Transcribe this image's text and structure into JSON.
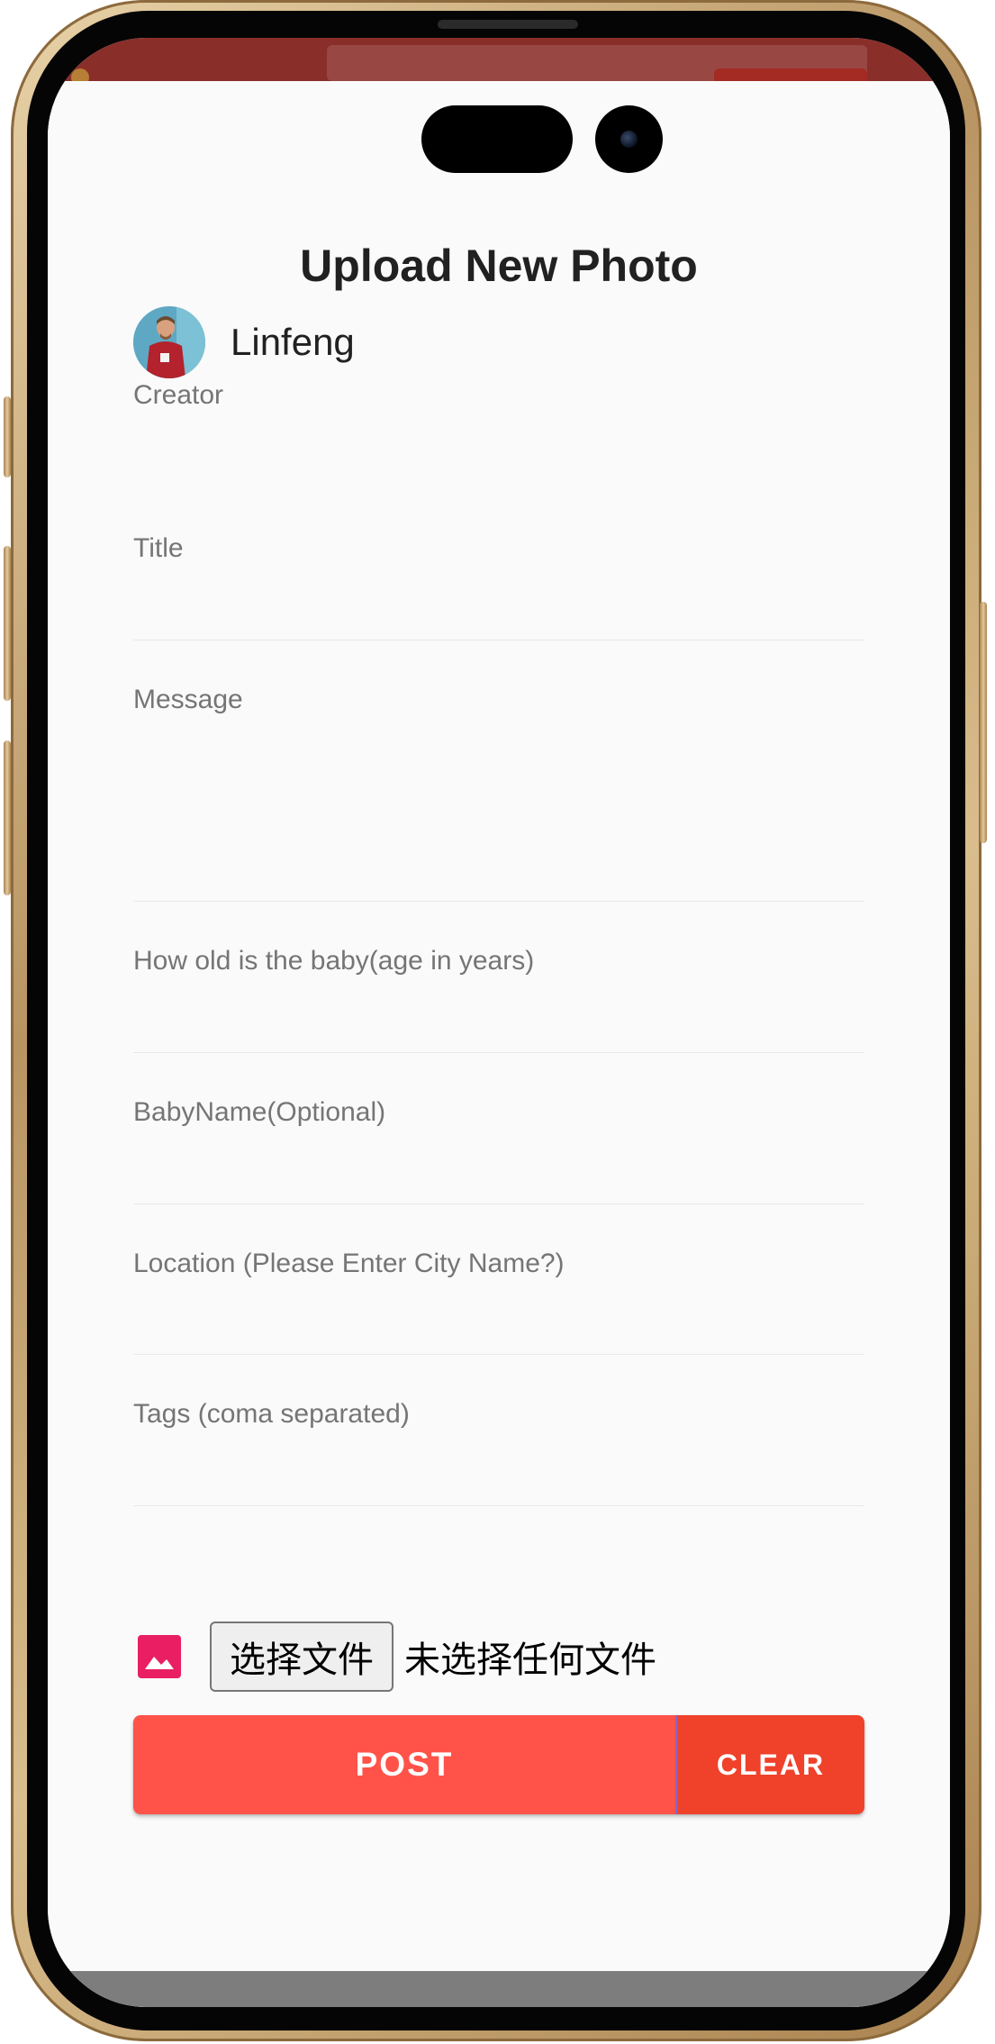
{
  "form": {
    "title": "Upload New Photo",
    "creator_name": "Linfeng",
    "creator_label": "Creator",
    "fields": {
      "title": "Title",
      "message": "Message",
      "age": "How old is the baby(age in years)",
      "baby_name": "BabyName(Optional)",
      "location": "Location (Please Enter City Name?)",
      "tags": "Tags (coma separated)"
    },
    "file_button_label": "选择文件",
    "file_status": "未选择任何文件",
    "post_label": "POST",
    "clear_label": "CLEAR"
  },
  "colors": {
    "post_button": "#ff5349",
    "clear_button": "#f0412a",
    "image_icon": "#e91e63",
    "background_appbar": "#8a2e2a"
  },
  "icons": {
    "image": "image-icon",
    "avatar": "avatar"
  }
}
